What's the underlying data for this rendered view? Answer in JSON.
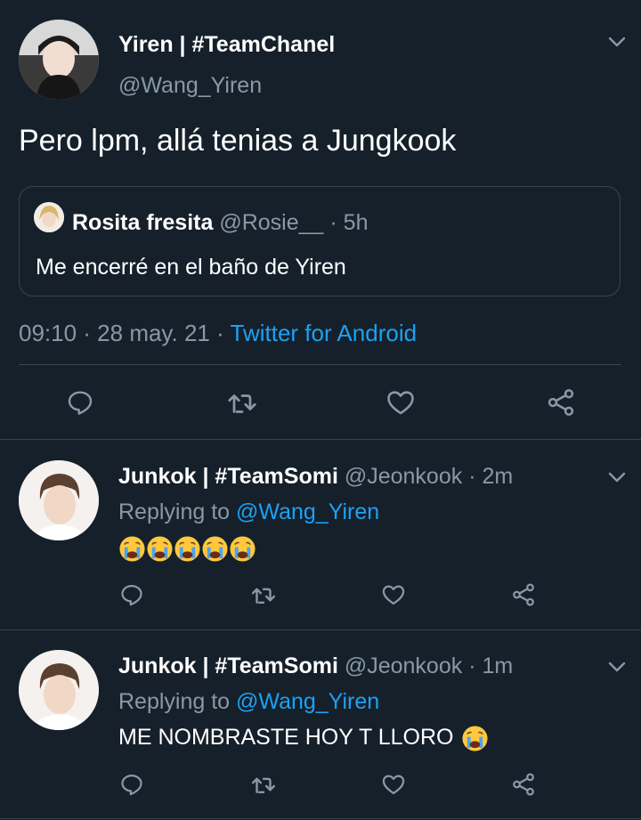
{
  "main_tweet": {
    "display_name": "Yiren | #TeamChanel",
    "handle": "@Wang_Yiren",
    "text": "Pero lpm, allá tenias a Jungkook",
    "quote": {
      "display_name": "Rosita fresita",
      "handle": "@Rosie__",
      "time": "· 5h",
      "text": "Me encerré en el baño de Yiren"
    },
    "timestamp": "09:10 · 28 may. 21 ·",
    "source": "Twitter for Android"
  },
  "replies": [
    {
      "display_name": "Junkok | #TeamSomi",
      "handle": "@Jeonkook",
      "time": "· 2m",
      "replying_prefix": "Replying to",
      "replying_to": "@Wang_Yiren",
      "text": "",
      "emoji": [
        "crying-face",
        "crying-face",
        "crying-face",
        "crying-face",
        "crying-face"
      ]
    },
    {
      "display_name": "Junkok | #TeamSomi",
      "handle": "@Jeonkook",
      "time": "· 1m",
      "replying_prefix": "Replying to",
      "replying_to": "@Wang_Yiren",
      "text": "ME NOMBRASTE HOY T LLORO",
      "emoji": [
        "crying-face"
      ]
    }
  ],
  "icons": {
    "reply": "reply-icon",
    "retweet": "retweet-icon",
    "like": "heart-icon",
    "share": "share-icon",
    "menu": "chevron-down-icon"
  },
  "colors": {
    "background": "#15202b",
    "text": "#ffffff",
    "muted": "#8899a6",
    "link": "#1da1f2",
    "divider": "#38444d"
  }
}
